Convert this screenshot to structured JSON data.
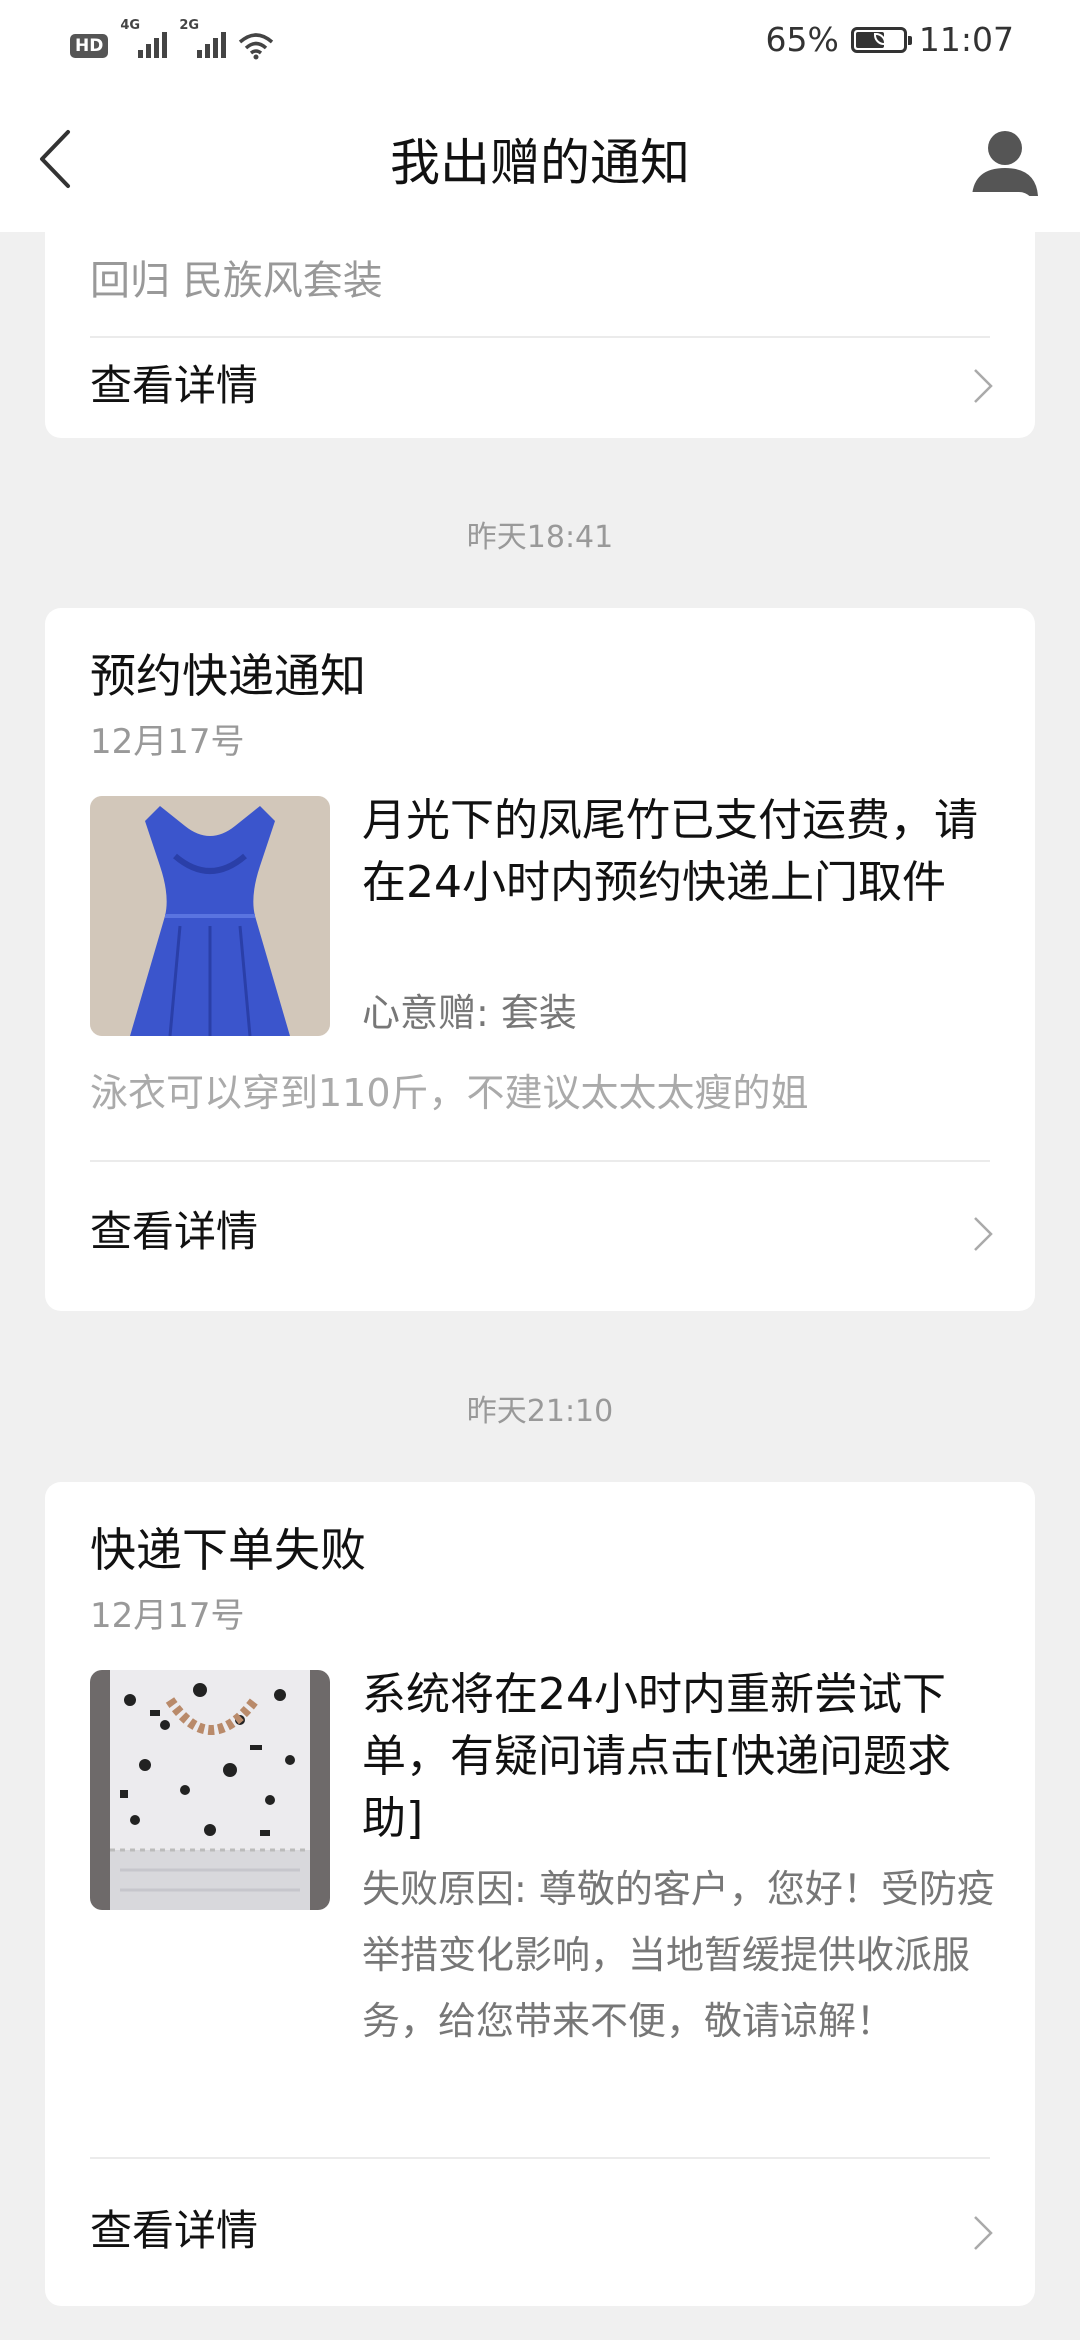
{
  "status_bar": {
    "hd_label": "HD",
    "sim1_tag": "4G",
    "sim2_tag": "2G",
    "battery_percent": "65%",
    "battery_level": 0.65,
    "time": "11:07",
    "icons": [
      "signal-icon",
      "wifi-icon",
      "battery-icon"
    ]
  },
  "nav": {
    "title": "我出赠的通知",
    "back_icon": "back-arrow-icon",
    "profile_icon": "profile-icon"
  },
  "cards": [
    {
      "partial_text": "回归  民族风套装",
      "detail_label": "查看详情"
    },
    {
      "timestamp": "昨天18:41",
      "title": "预约快递通知",
      "date": "12月17号",
      "body": "月光下的凤尾竹已支付运费，请在24小时内预约快递上门取件",
      "sub": "心意赠: 套装",
      "note": "泳衣可以穿到110斤，不建议太太太瘦的姐",
      "detail_label": "查看详情",
      "thumb_color": "#3b55cc"
    },
    {
      "timestamp": "昨天21:10",
      "title": "快递下单失败",
      "date": "12月17号",
      "body": "系统将在24小时内重新尝试下单，有疑问请点击[快递问题求助]",
      "sub": "失败原因: 尊敬的客户，您好！受防疫举措变化影响，当地暂缓提供收派服务，给您带来不便，敬请谅解！",
      "detail_label": "查看详情",
      "thumb_color": "#e8e8ea"
    }
  ],
  "colors": {
    "background": "#f0f0f0",
    "card": "#ffffff",
    "secondary_text": "#999999",
    "divider": "#ebebeb"
  }
}
